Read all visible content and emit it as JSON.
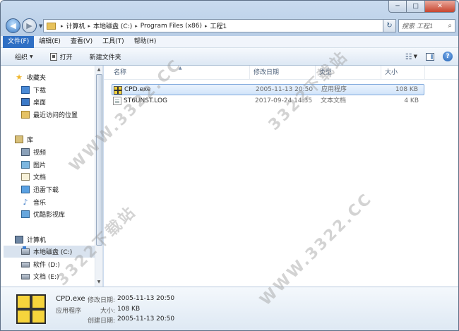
{
  "window": {
    "controls": {
      "minimize": "─",
      "maximize": "□",
      "close": "✕"
    }
  },
  "nav": {
    "back_glyph": "◀",
    "forward_glyph": "▶",
    "dropdown_glyph": "▼"
  },
  "address": {
    "crumbs": [
      "计算机",
      "本地磁盘 (C:)",
      "Program Files (x86)",
      "工程1"
    ],
    "separator": "▸",
    "refresh_glyph": "↻"
  },
  "search": {
    "placeholder": "搜索 工程1",
    "icon": "search-icon"
  },
  "menu": {
    "items": [
      "文件(F)",
      "编辑(E)",
      "查看(V)",
      "工具(T)",
      "帮助(H)"
    ]
  },
  "toolbar": {
    "organize": "组织",
    "open": "打开",
    "new_folder": "新建文件夹",
    "view_glyph": "☷",
    "help_glyph": "?"
  },
  "sidebar": {
    "favorites_title": "收藏夹",
    "favorites": [
      "下载",
      "桌面",
      "最近访问的位置"
    ],
    "libraries_title": "库",
    "libraries": [
      "视频",
      "图片",
      "文档",
      "迅雷下载",
      "音乐",
      "优酷影视库"
    ],
    "computer_title": "计算机",
    "drives": [
      "本地磁盘 (C:)",
      "软件 (D:)",
      "文档 (E:)"
    ]
  },
  "columns": {
    "name": "名称",
    "date": "修改日期",
    "type": "类型",
    "size": "大小"
  },
  "files": [
    {
      "name": "CPD.exe",
      "date": "2005-11-13 20:50",
      "type": "应用程序",
      "size": "108 KB"
    },
    {
      "name": "ST6UNST.LOG",
      "date": "2017-09-24 14:35",
      "type": "文本文档",
      "size": "4 KB"
    }
  ],
  "details": {
    "name": "CPD.exe",
    "type": "应用程序",
    "modified_label": "修改日期:",
    "modified_value": "2005-11-13 20:50",
    "size_label": "大小:",
    "size_value": "108 KB",
    "created_label": "创建日期:",
    "created_value": "2005-11-13 20:50"
  },
  "watermark": "WWW.3322.CC",
  "watermark_cn": "3322下载站",
  "colors": {
    "accent": "#2f6fc4",
    "selection": "#d2e5fa",
    "chrome": "#cddcef"
  }
}
